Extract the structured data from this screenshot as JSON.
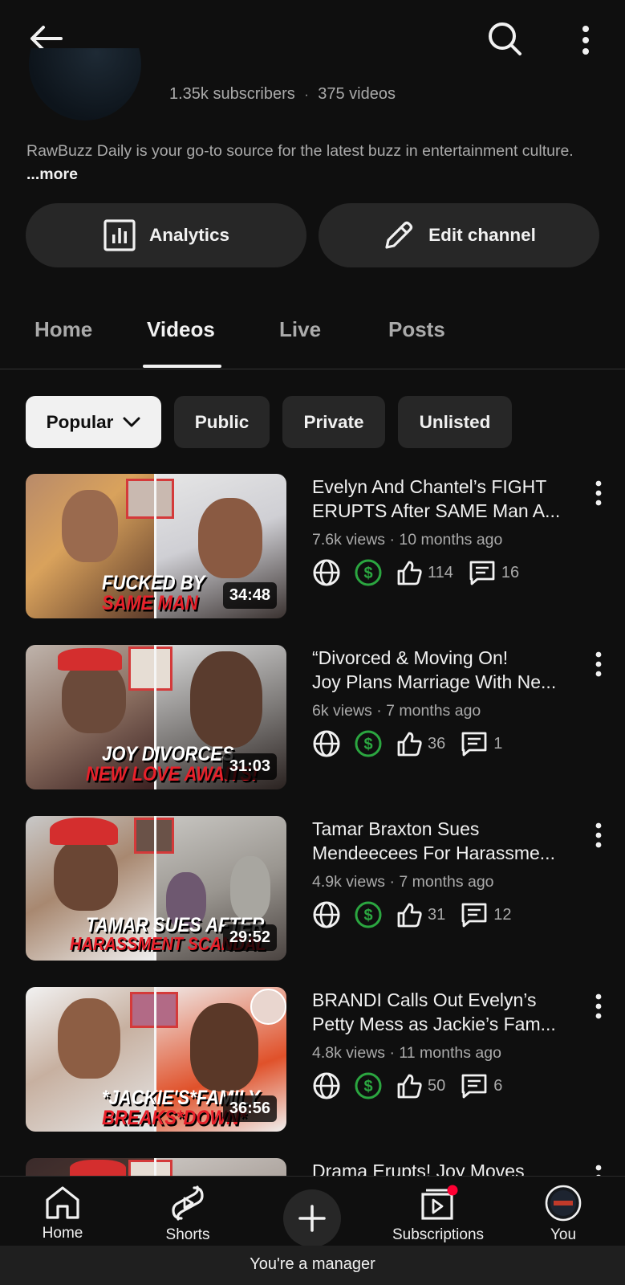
{
  "channel": {
    "subscribers": "1.35k subscribers",
    "separator": "·",
    "videos_count": "375 videos",
    "description": "RawBuzz Daily is your go-to source for the latest buzz in entertainment culture.",
    "more_label": "...more"
  },
  "actions": {
    "analytics_label": "Analytics",
    "edit_label": "Edit channel"
  },
  "tabs": [
    {
      "label": "Home"
    },
    {
      "label": "Videos"
    },
    {
      "label": "Live"
    },
    {
      "label": "Posts"
    }
  ],
  "active_tab": "Videos",
  "filters": [
    {
      "label": "Popular"
    },
    {
      "label": "Public"
    },
    {
      "label": "Private"
    },
    {
      "label": "Unlisted"
    }
  ],
  "videos": [
    {
      "title_line1": "Evelyn And Chantel’s FIGHT",
      "title_line2": "ERUPTS After SAME Man A...",
      "meta": "7.6k views · 10 months ago",
      "likes": "114",
      "comments": "16",
      "duration": "34:48",
      "caption1": "FUCKED BY",
      "caption2": "SAME MAN"
    },
    {
      "title_line1": "“Divorced & Moving On!",
      "title_line2": "Joy Plans Marriage With Ne...",
      "meta": "6k views · 7 months ago",
      "likes": "36",
      "comments": "1",
      "duration": "31:03",
      "caption1": "JOY DIVORCES",
      "caption2": "NEW LOVE AWAITS!"
    },
    {
      "title_line1": "Tamar Braxton Sues",
      "title_line2": "Mendeecees For Harassme...",
      "meta": "4.9k views · 7 months ago",
      "likes": "31",
      "comments": "12",
      "duration": "29:52",
      "caption1": "TAMAR SUES AFTER",
      "caption2": "HARASSMENT SCANDAL"
    },
    {
      "title_line1": "BRANDI Calls Out Evelyn’s",
      "title_line2": "Petty Mess as Jackie’s Fam...",
      "meta": "4.8k views · 11 months ago",
      "likes": "50",
      "comments": "6",
      "duration": "36:56",
      "caption1": "*JACKIE'S*FAMILY",
      "caption2": "BREAKS*DOWN*"
    },
    {
      "title_line1": "Drama Erupts! Joy Moves",
      "title_line2": "",
      "meta": "",
      "likes": "",
      "comments": "",
      "duration": "",
      "caption1": "",
      "caption2": ""
    }
  ],
  "bottom_nav": {
    "home": "Home",
    "shorts": "Shorts",
    "subscriptions": "Subscriptions",
    "you": "You"
  },
  "manager_notice": "You're a manager",
  "colors": {
    "background": "#0f0f0f",
    "surface": "#272727",
    "text_primary": "#f1f1f1",
    "text_secondary": "#aaaaaa",
    "monetization_green": "#2ba640",
    "notification_red": "#ff0033"
  }
}
